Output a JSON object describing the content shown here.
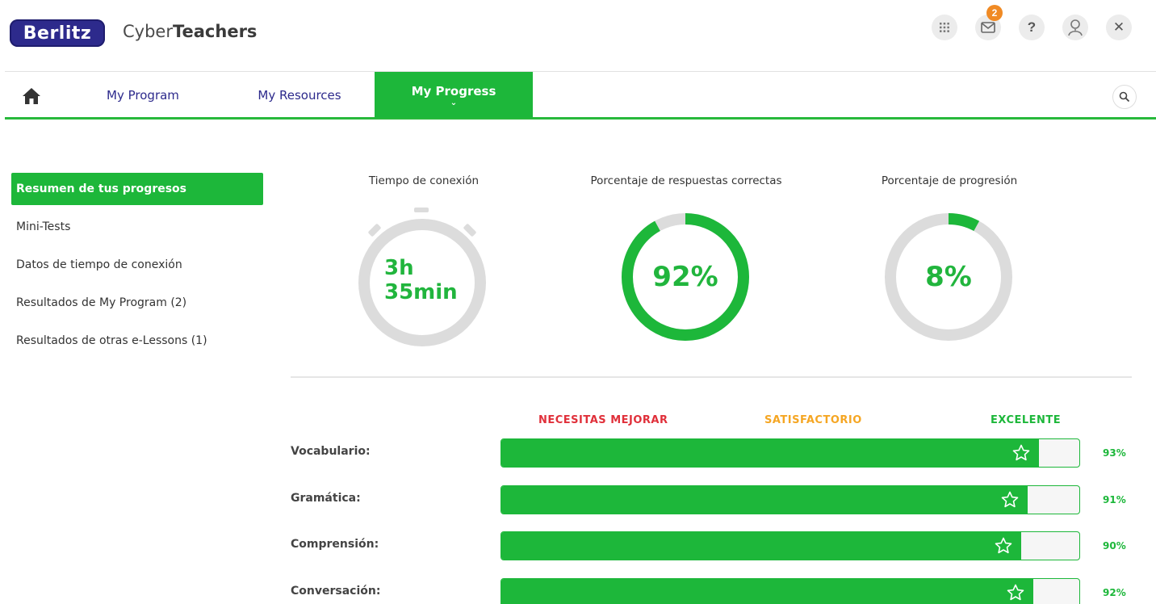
{
  "header": {
    "brand": "Berlitz",
    "product_light": "Cyber",
    "product_bold": "Teachers",
    "icons": [
      {
        "name": "apps-grid-icon",
        "glyph": "⋮⋮⋮"
      },
      {
        "name": "mail-icon",
        "glyph": "✉",
        "badge": "2"
      },
      {
        "name": "help-icon",
        "glyph": "?"
      },
      {
        "name": "user-avatar-icon",
        "glyph": "☺"
      },
      {
        "name": "close-icon",
        "glyph": "✕"
      }
    ]
  },
  "nav": {
    "tabs": [
      {
        "label": "My Program"
      },
      {
        "label": "My Resources"
      },
      {
        "label": "My Progress",
        "active": true
      }
    ]
  },
  "sidebar": {
    "items": [
      {
        "label": "Resumen de tus progresos",
        "active": true
      },
      {
        "label": "Mini-Tests"
      },
      {
        "label": "Datos de tiempo de conexión"
      },
      {
        "label": "Resultados de My Program (2)"
      },
      {
        "label": "Resultados de otras e-Lessons (1)"
      }
    ]
  },
  "stats": {
    "connection": {
      "label": "Tiempo de conexión",
      "line1": "3h",
      "line2": "35min"
    },
    "correct": {
      "label": "Porcentaje de respuestas correctas",
      "value": "92%",
      "fraction": 0.92
    },
    "progression": {
      "label": "Porcentaje de progresión",
      "value": "8%",
      "fraction": 0.08
    }
  },
  "levels": {
    "low": {
      "label": "NECESITAS MEJORAR",
      "color": "#e0303a"
    },
    "mid": {
      "label": "SATISFACTORIO",
      "color": "#f5a623"
    },
    "high": {
      "label": "EXCELENTE",
      "color": "#1db73a"
    }
  },
  "skills": [
    {
      "label": "Vocabulario:",
      "pct": "93%",
      "fraction": 0.93
    },
    {
      "label": "Gramática:",
      "pct": "91%",
      "fraction": 0.91
    },
    {
      "label": "Comprensión:",
      "pct": "90%",
      "fraction": 0.9
    },
    {
      "label": "Conversación:",
      "pct": "92%",
      "fraction": 0.92
    }
  ],
  "colors": {
    "accent": "#1db73a",
    "brand": "#2d2a8c",
    "ring_track": "#dcdcdc"
  }
}
